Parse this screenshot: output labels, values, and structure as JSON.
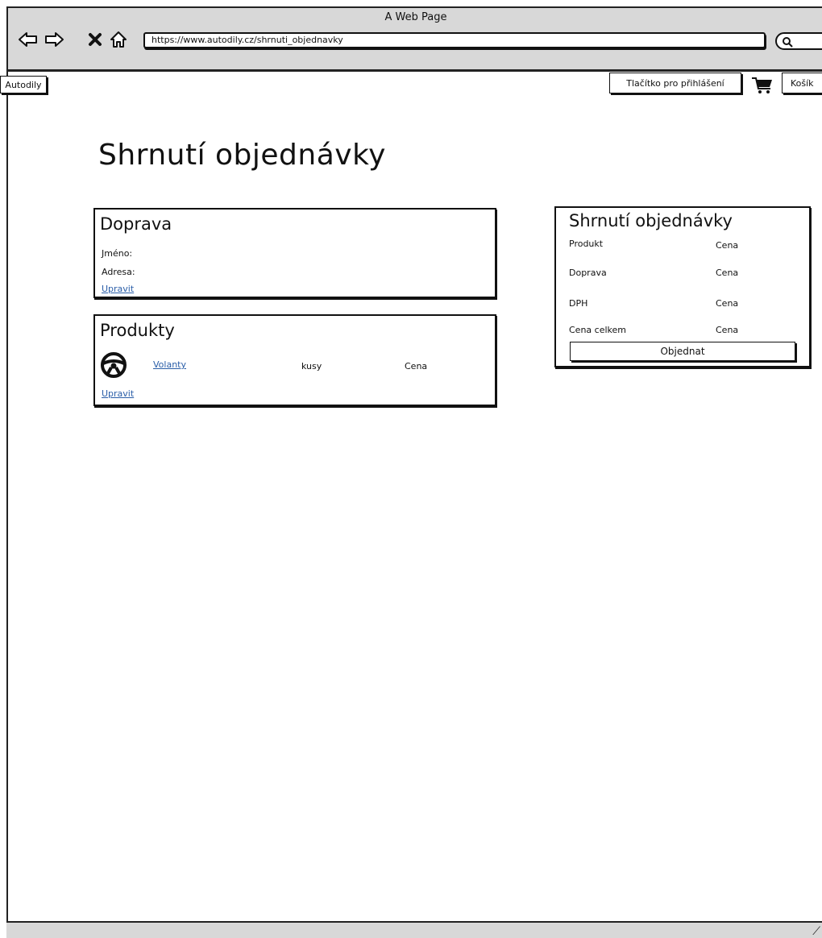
{
  "window": {
    "title": "A Web Page"
  },
  "browser": {
    "url": "https://www.autodily.cz/shrnuti_objednavky",
    "icons": [
      "back-arrow-icon",
      "forward-arrow-icon",
      "stop-icon",
      "home-icon",
      "search-icon"
    ]
  },
  "header": {
    "logo_label": "Autodily",
    "login_label": "Tlačítko pro přihlášení",
    "cart_label": "Košík"
  },
  "main": {
    "title": "Shrnutí objednávky",
    "shipping": {
      "title": "Doprava",
      "name_label": "Jméno:",
      "address_label": "Adresa:",
      "edit_label": "Upravit"
    },
    "products": {
      "title": "Produkty",
      "item": {
        "name": "Volanty",
        "quantity_label": "kusy",
        "price_label": "Cena",
        "icon": "steering-wheel-icon"
      },
      "edit_label": "Upravit"
    },
    "summary": {
      "title": "Shrnutí objednávky",
      "rows": [
        {
          "label": "Produkt",
          "value": "Cena"
        },
        {
          "label": "Doprava",
          "value": "Cena"
        },
        {
          "label": "DPH",
          "value": "Cena"
        },
        {
          "label": "Cena celkem",
          "value": "Cena"
        }
      ],
      "order_button_label": "Objednat"
    }
  }
}
